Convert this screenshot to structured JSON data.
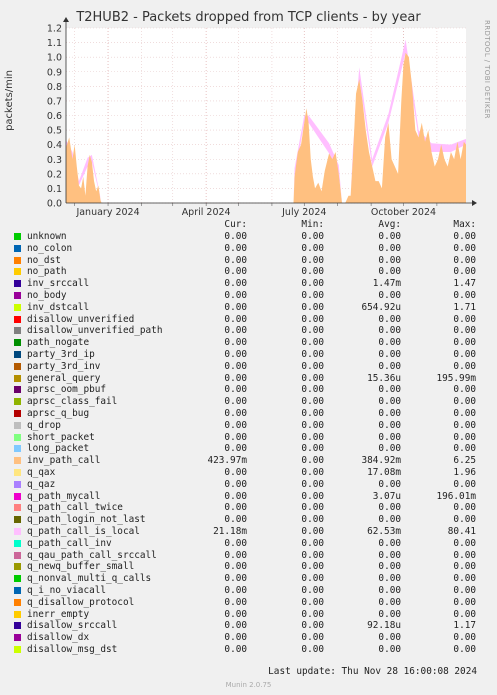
{
  "title": "T2HUB2 - Packets dropped from TCP clients - by year",
  "side_text": "RRDTOOL / TOBI OETIKER",
  "footer": {
    "last_update": "Last update: Thu Nov 28 16:00:08 2024",
    "munin": "Munin 2.0.75"
  },
  "legend_headers": {
    "cur": "Cur:",
    "min": "Min:",
    "avg": "Avg:",
    "max": "Max:"
  },
  "legend": [
    {
      "name": "unknown",
      "color": "#00cc00",
      "cur": "0.00",
      "min": "0.00",
      "avg": "0.00",
      "max": "0.00"
    },
    {
      "name": "no_colon",
      "color": "#0066b3",
      "cur": "0.00",
      "min": "0.00",
      "avg": "0.00",
      "max": "0.00"
    },
    {
      "name": "no_dst",
      "color": "#ff8000",
      "cur": "0.00",
      "min": "0.00",
      "avg": "0.00",
      "max": "0.00"
    },
    {
      "name": "no_path",
      "color": "#ffcc00",
      "cur": "0.00",
      "min": "0.00",
      "avg": "0.00",
      "max": "0.00"
    },
    {
      "name": "inv_srccall",
      "color": "#330099",
      "cur": "0.00",
      "min": "0.00",
      "avg": "1.47m",
      "max": "1.47"
    },
    {
      "name": "no_body",
      "color": "#990099",
      "cur": "0.00",
      "min": "0.00",
      "avg": "0.00",
      "max": "0.00"
    },
    {
      "name": "inv_dstcall",
      "color": "#ccff00",
      "cur": "0.00",
      "min": "0.00",
      "avg": "654.92u",
      "max": "1.71"
    },
    {
      "name": "disallow_unverified",
      "color": "#ff0000",
      "cur": "0.00",
      "min": "0.00",
      "avg": "0.00",
      "max": "0.00"
    },
    {
      "name": "disallow_unverified_path",
      "color": "#808080",
      "cur": "0.00",
      "min": "0.00",
      "avg": "0.00",
      "max": "0.00"
    },
    {
      "name": "path_nogate",
      "color": "#008f00",
      "cur": "0.00",
      "min": "0.00",
      "avg": "0.00",
      "max": "0.00"
    },
    {
      "name": "party_3rd_ip",
      "color": "#00487d",
      "cur": "0.00",
      "min": "0.00",
      "avg": "0.00",
      "max": "0.00"
    },
    {
      "name": "party_3rd_inv",
      "color": "#b35a00",
      "cur": "0.00",
      "min": "0.00",
      "avg": "0.00",
      "max": "0.00"
    },
    {
      "name": "general_query",
      "color": "#b38f00",
      "cur": "0.00",
      "min": "0.00",
      "avg": "15.36u",
      "max": "195.99m"
    },
    {
      "name": "aprsc_oom_pbuf",
      "color": "#6b006b",
      "cur": "0.00",
      "min": "0.00",
      "avg": "0.00",
      "max": "0.00"
    },
    {
      "name": "aprsc_class_fail",
      "color": "#8fb300",
      "cur": "0.00",
      "min": "0.00",
      "avg": "0.00",
      "max": "0.00"
    },
    {
      "name": "aprsc_q_bug",
      "color": "#b30000",
      "cur": "0.00",
      "min": "0.00",
      "avg": "0.00",
      "max": "0.00"
    },
    {
      "name": "q_drop",
      "color": "#bebebe",
      "cur": "0.00",
      "min": "0.00",
      "avg": "0.00",
      "max": "0.00"
    },
    {
      "name": "short_packet",
      "color": "#80ff80",
      "cur": "0.00",
      "min": "0.00",
      "avg": "0.00",
      "max": "0.00"
    },
    {
      "name": "long_packet",
      "color": "#80c9ff",
      "cur": "0.00",
      "min": "0.00",
      "avg": "0.00",
      "max": "0.00"
    },
    {
      "name": "inv_path_call",
      "color": "#ffc080",
      "cur": "423.97m",
      "min": "0.00",
      "avg": "384.92m",
      "max": "6.25"
    },
    {
      "name": "q_qax",
      "color": "#ffe680",
      "cur": "0.00",
      "min": "0.00",
      "avg": "17.08m",
      "max": "1.96"
    },
    {
      "name": "q_qaz",
      "color": "#aa80ff",
      "cur": "0.00",
      "min": "0.00",
      "avg": "0.00",
      "max": "0.00"
    },
    {
      "name": "q_path_mycall",
      "color": "#ee00cc",
      "cur": "0.00",
      "min": "0.00",
      "avg": "3.07u",
      "max": "196.01m"
    },
    {
      "name": "q_path_call_twice",
      "color": "#ff8080",
      "cur": "0.00",
      "min": "0.00",
      "avg": "0.00",
      "max": "0.00"
    },
    {
      "name": "q_path_login_not_last",
      "color": "#666600",
      "cur": "0.00",
      "min": "0.00",
      "avg": "0.00",
      "max": "0.00"
    },
    {
      "name": "q_path_call_is_local",
      "color": "#ffbfff",
      "cur": "21.18m",
      "min": "0.00",
      "avg": "62.53m",
      "max": "80.41"
    },
    {
      "name": "q_path_call_inv",
      "color": "#00ffcc",
      "cur": "0.00",
      "min": "0.00",
      "avg": "0.00",
      "max": "0.00"
    },
    {
      "name": "q_qau_path_call_srccall",
      "color": "#cc6699",
      "cur": "0.00",
      "min": "0.00",
      "avg": "0.00",
      "max": "0.00"
    },
    {
      "name": "q_newq_buffer_small",
      "color": "#999900",
      "cur": "0.00",
      "min": "0.00",
      "avg": "0.00",
      "max": "0.00"
    },
    {
      "name": "q_nonval_multi_q_calls",
      "color": "#00cc00",
      "cur": "0.00",
      "min": "0.00",
      "avg": "0.00",
      "max": "0.00"
    },
    {
      "name": "q_i_no_viacall",
      "color": "#0066b3",
      "cur": "0.00",
      "min": "0.00",
      "avg": "0.00",
      "max": "0.00"
    },
    {
      "name": "q_disallow_protocol",
      "color": "#ff8000",
      "cur": "0.00",
      "min": "0.00",
      "avg": "0.00",
      "max": "0.00"
    },
    {
      "name": "inerr_empty",
      "color": "#ffcc00",
      "cur": "0.00",
      "min": "0.00",
      "avg": "0.00",
      "max": "0.00"
    },
    {
      "name": "disallow_srccall",
      "color": "#330099",
      "cur": "0.00",
      "min": "0.00",
      "avg": "92.18u",
      "max": "1.17"
    },
    {
      "name": "disallow_dx",
      "color": "#990099",
      "cur": "0.00",
      "min": "0.00",
      "avg": "0.00",
      "max": "0.00"
    },
    {
      "name": "disallow_msg_dst",
      "color": "#ccff00",
      "cur": "0.00",
      "min": "0.00",
      "avg": "0.00",
      "max": "0.00"
    }
  ],
  "chart_data": {
    "type": "area",
    "title": "T2HUB2 - Packets dropped from TCP clients - by year",
    "ylabel": "packets/min",
    "ylim": [
      0,
      1.2
    ],
    "yticks": [
      "0.0",
      "0.1",
      "0.2",
      "0.3",
      "0.4",
      "0.5",
      "0.6",
      "0.7",
      "0.8",
      "0.9",
      "1.0",
      "1.1",
      "1.2"
    ],
    "x_range": [
      "2023-11-23",
      "2024-11-28"
    ],
    "x_ticks": [
      {
        "label": "January 2024",
        "date": "2024-01-01"
      },
      {
        "label": "April 2024",
        "date": "2024-04-01"
      },
      {
        "label": "July 2024",
        "date": "2024-07-01"
      },
      {
        "label": "October 2024",
        "date": "2024-10-01"
      }
    ],
    "grid": true,
    "series": [
      {
        "name": "inv_path_call",
        "color": "#ffc080",
        "points": [
          [
            "2023-11-23",
            0.38
          ],
          [
            "2023-11-26",
            0.45
          ],
          [
            "2023-11-29",
            0.3
          ],
          [
            "2023-12-01",
            0.4
          ],
          [
            "2023-12-03",
            0.25
          ],
          [
            "2023-12-05",
            0.12
          ],
          [
            "2023-12-07",
            0.1
          ],
          [
            "2023-12-09",
            0.18
          ],
          [
            "2023-12-11",
            0.05
          ],
          [
            "2023-12-13",
            0.25
          ],
          [
            "2023-12-15",
            0.33
          ],
          [
            "2023-12-17",
            0.28
          ],
          [
            "2023-12-19",
            0.15
          ],
          [
            "2023-12-21",
            0.08
          ],
          [
            "2023-12-23",
            0.12
          ],
          [
            "2023-12-25",
            0.02
          ],
          [
            "2023-12-26",
            0.0
          ],
          [
            "2024-06-21",
            0.0
          ],
          [
            "2024-06-22",
            0.18
          ],
          [
            "2024-06-25",
            0.35
          ],
          [
            "2024-06-28",
            0.4
          ],
          [
            "2024-07-01",
            0.55
          ],
          [
            "2024-07-03",
            0.65
          ],
          [
            "2024-07-05",
            0.55
          ],
          [
            "2024-07-07",
            0.3
          ],
          [
            "2024-07-09",
            0.18
          ],
          [
            "2024-07-11",
            0.1
          ],
          [
            "2024-07-14",
            0.14
          ],
          [
            "2024-07-17",
            0.08
          ],
          [
            "2024-07-20",
            0.22
          ],
          [
            "2024-07-24",
            0.34
          ],
          [
            "2024-07-27",
            0.3
          ],
          [
            "2024-07-30",
            0.35
          ],
          [
            "2024-08-02",
            0.2
          ],
          [
            "2024-08-05",
            0.0
          ],
          [
            "2024-08-08",
            0.0
          ],
          [
            "2024-08-11",
            0.05
          ],
          [
            "2024-08-13",
            0.05
          ],
          [
            "2024-08-15",
            0.3
          ],
          [
            "2024-08-18",
            0.75
          ],
          [
            "2024-08-21",
            0.85
          ],
          [
            "2024-08-24",
            0.7
          ],
          [
            "2024-08-27",
            0.5
          ],
          [
            "2024-08-30",
            0.35
          ],
          [
            "2024-09-02",
            0.25
          ],
          [
            "2024-09-05",
            0.15
          ],
          [
            "2024-09-08",
            0.15
          ],
          [
            "2024-09-11",
            0.1
          ],
          [
            "2024-09-14",
            0.45
          ],
          [
            "2024-09-17",
            0.55
          ],
          [
            "2024-09-20",
            0.3
          ],
          [
            "2024-09-23",
            0.25
          ],
          [
            "2024-09-26",
            0.2
          ],
          [
            "2024-09-29",
            0.7
          ],
          [
            "2024-10-01",
            0.95
          ],
          [
            "2024-10-03",
            1.03
          ],
          [
            "2024-10-06",
            1.0
          ],
          [
            "2024-10-09",
            0.8
          ],
          [
            "2024-10-12",
            0.5
          ],
          [
            "2024-10-15",
            0.45
          ],
          [
            "2024-10-18",
            0.55
          ],
          [
            "2024-10-21",
            0.42
          ],
          [
            "2024-10-24",
            0.5
          ],
          [
            "2024-10-27",
            0.35
          ],
          [
            "2024-10-30",
            0.25
          ],
          [
            "2024-11-02",
            0.3
          ],
          [
            "2024-11-05",
            0.4
          ],
          [
            "2024-11-08",
            0.3
          ],
          [
            "2024-11-11",
            0.25
          ],
          [
            "2024-11-14",
            0.35
          ],
          [
            "2024-11-17",
            0.3
          ],
          [
            "2024-11-20",
            0.42
          ],
          [
            "2024-11-23",
            0.3
          ],
          [
            "2024-11-26",
            0.42
          ],
          [
            "2024-11-28",
            0.4
          ]
        ]
      },
      {
        "name": "q_path_call_is_local",
        "color": "#ffbfff",
        "points": [
          [
            "2023-11-23",
            0.05
          ],
          [
            "2023-11-29",
            0.05
          ],
          [
            "2023-12-05",
            0.03
          ],
          [
            "2023-12-13",
            0.06
          ],
          [
            "2023-12-17",
            0.05
          ],
          [
            "2023-12-26",
            0.0
          ],
          [
            "2024-06-21",
            0.0
          ],
          [
            "2024-06-22",
            0.06
          ],
          [
            "2024-07-01",
            0.05
          ],
          [
            "2024-07-05",
            0.05
          ],
          [
            "2024-07-24",
            0.07
          ],
          [
            "2024-08-02",
            0.06
          ],
          [
            "2024-08-05",
            0.0
          ],
          [
            "2024-08-13",
            0.0
          ],
          [
            "2024-08-15",
            0.06
          ],
          [
            "2024-08-21",
            0.08
          ],
          [
            "2024-09-02",
            0.05
          ],
          [
            "2024-09-17",
            0.06
          ],
          [
            "2024-10-03",
            0.09
          ],
          [
            "2024-10-15",
            0.05
          ],
          [
            "2024-10-27",
            0.06
          ],
          [
            "2024-11-14",
            0.05
          ],
          [
            "2024-11-28",
            0.04
          ]
        ]
      }
    ]
  }
}
